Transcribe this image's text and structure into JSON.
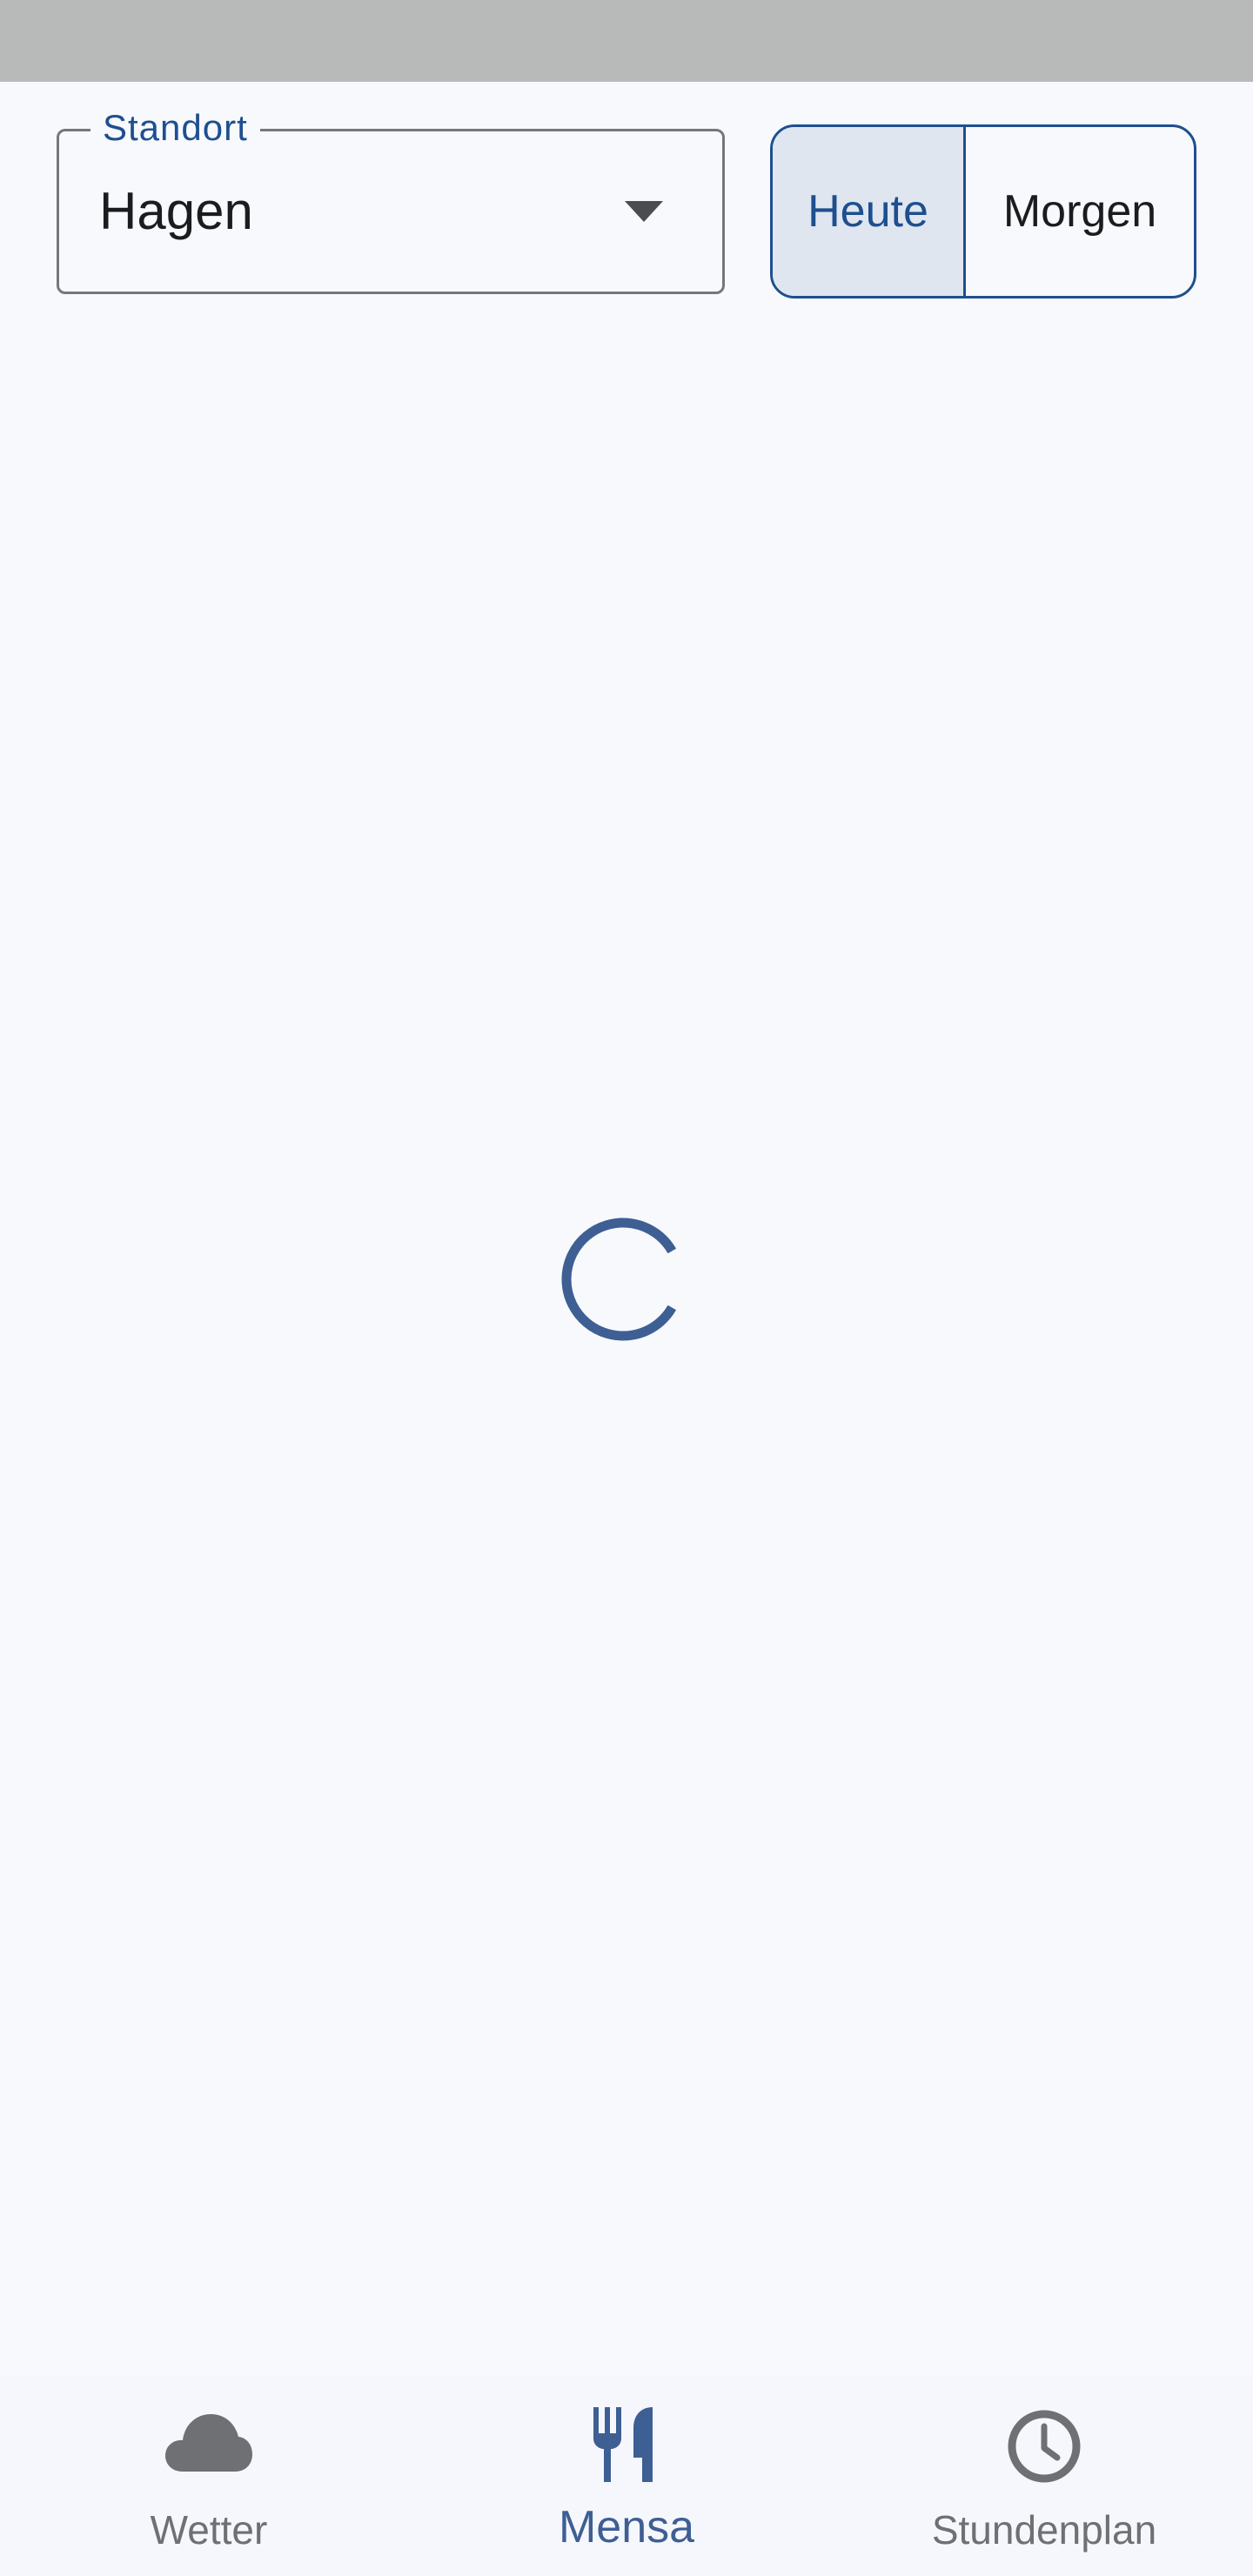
{
  "location": {
    "label": "Standort",
    "value": "Hagen",
    "icon": "arrow-drop-down-icon"
  },
  "day_toggle": {
    "options": [
      {
        "label": "Heute",
        "selected": true
      },
      {
        "label": "Morgen",
        "selected": false
      }
    ]
  },
  "loading": {
    "icon": "loading-spinner"
  },
  "bottom_nav": {
    "items": [
      {
        "label": "Wetter",
        "icon": "cloud-icon",
        "active": false
      },
      {
        "label": "Mensa",
        "icon": "restaurant-icon",
        "active": true
      },
      {
        "label": "Stundenplan",
        "icon": "clock-icon",
        "active": false
      }
    ]
  },
  "colors": {
    "primary": "#1e4f8f",
    "accent": "#3e5f94",
    "selected_segment": "#dfe6ef",
    "background": "#f7f9fc",
    "status_bar": "#b8b9b9",
    "inactive": "#6e7074"
  }
}
